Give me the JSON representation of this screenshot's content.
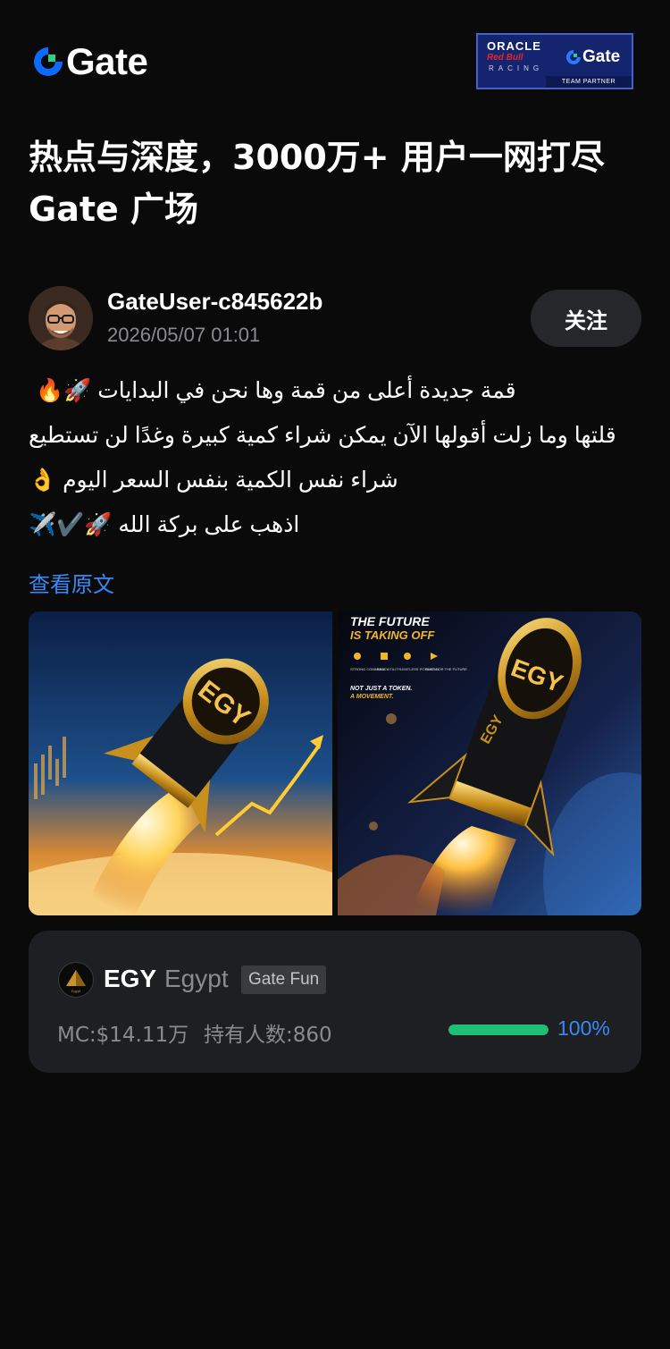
{
  "header": {
    "logo_text": "Gate",
    "partner": {
      "line1": "ORACLE",
      "line2": "Red Bull",
      "line3": "RACING",
      "brand": "Gate",
      "tag": "TEAM PARTNER"
    },
    "brand_color": "#0a6cff"
  },
  "headline": {
    "line1": "热点与深度，3000万+ 用户一网打尽",
    "line2": "Gate 广场"
  },
  "author": {
    "name": "GateUser-c845622b",
    "date": "2026/05/07 01:01",
    "follow_label": "关注"
  },
  "post": {
    "lines": [
      "قمة جديدة أعلى من قمة وها نحن في البدايات 🚀🔥",
      "قلتها وما زلت أقولها الآن يمكن شراء كمية كبيرة وغدًا لن تستطيع",
      "شراء نفس الكمية بنفس السعر اليوم 👌",
      "اذهب على بركة الله 🚀✔️✈️"
    ],
    "view_original": "查看原文"
  },
  "images": {
    "left_coin_text": "EGY",
    "right_title1": "THE FUTURE",
    "right_title2": "IS TAKING OFF",
    "right_features": [
      "STRONG COMMUNITY",
      "REAL UTILITY",
      "LIMITLESS POTENTIAL",
      "BUILT FOR THE FUTURE"
    ],
    "right_tag1": "NOT JUST A TOKEN.",
    "right_tag2": "A MOVEMENT.",
    "right_coin_text": "EGY",
    "right_body_text": "EGY"
  },
  "token": {
    "icon_text": "Egypt",
    "symbol": "EGY",
    "name": "Egypt",
    "badge": "Gate Fun",
    "market_cap": "MC:$14.11万",
    "holders": "持有人数:860",
    "progress_label": "100%",
    "progress": 1.0,
    "progress_color": "#1fbf75"
  }
}
